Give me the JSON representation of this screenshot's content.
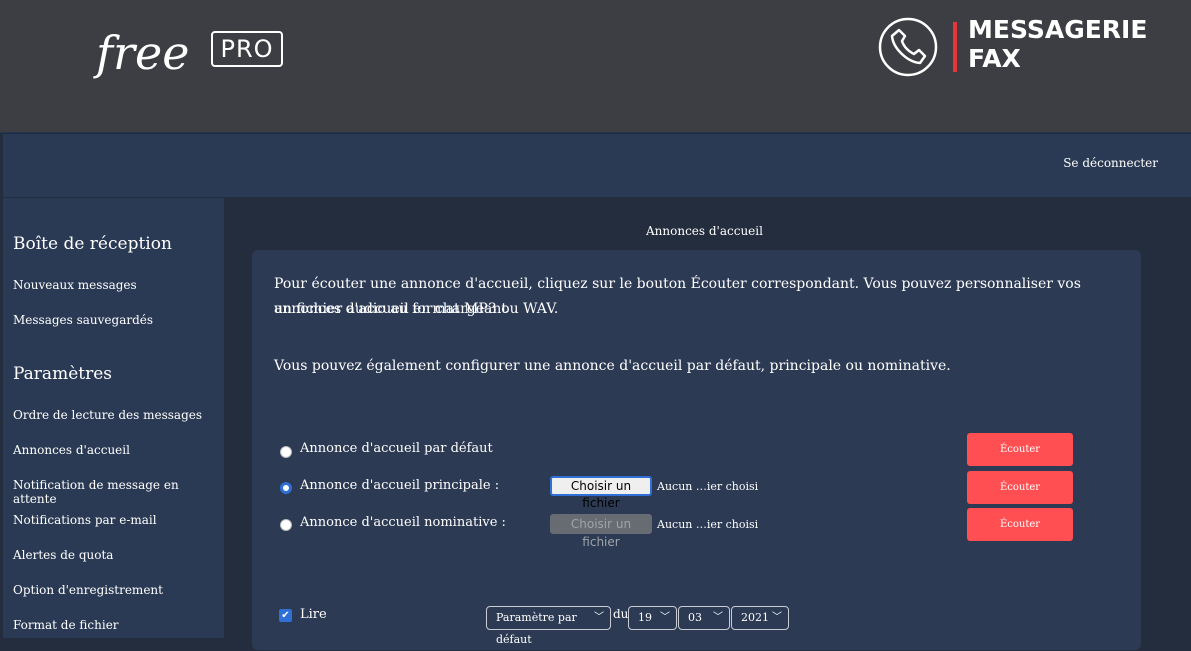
{
  "header": {
    "logo_text": "free",
    "logo_badge": "PRO",
    "product_title_line1": "MESSAGERIE",
    "product_title_line2": "FAX"
  },
  "topbar": {
    "logout_label": "Se déconnecter"
  },
  "sidebar": {
    "inbox_heading": "Boîte de réception",
    "inbox_items": [
      "Nouveaux messages",
      "Messages sauvegardés"
    ],
    "settings_heading": "Paramètres",
    "settings_items": [
      "Ordre de lecture des messages",
      "Annonces d'accueil",
      "Notification de message en attente",
      "Notifications par e-mail",
      "Alertes de quota",
      "Option d'enregistrement",
      "Format de fichier"
    ]
  },
  "main": {
    "section_title": "Annonces d'accueil",
    "intro_line1": "Pour écouter une annonce d'accueil, cliquez sur le bouton Écouter correspondant. Vous pouvez personnaliser vos annonces d'accueil en chargeant",
    "intro_line2": "un fichier audio au format MP3 ou WAV.",
    "intro_line3": "Vous pouvez également configurer une annonce d'accueil par défaut, principale ou nominative.",
    "options": [
      {
        "label": "Annonce d'accueil par défaut",
        "selected": false,
        "listen_label": "Écouter"
      },
      {
        "label": "Annonce d'accueil principale :",
        "selected": true,
        "file_button": "Choisir un fichier",
        "file_status": "Aucun …ier choisi",
        "listen_label": "Écouter"
      },
      {
        "label": "Annonce d'accueil nominative :",
        "selected": false,
        "file_button": "Choisir un fichier",
        "file_status": "Aucun …ier choisi",
        "listen_label": "Écouter"
      }
    ],
    "play": {
      "checkbox_label": "Lire",
      "checked": true,
      "mode_select": "Paramètre par défaut",
      "du_label": "du",
      "day": "19",
      "month": "03",
      "year": "2021"
    }
  },
  "colors": {
    "header_bg": "#3d3e43",
    "nav_bg": "#2b3a54",
    "page_bg": "#232d3d",
    "accent_red": "#ff4f52",
    "radio_blue": "#2f6fd6"
  },
  "icons": {
    "phone": "phone-icon",
    "check": "checkmark-icon",
    "chevron": "chevron-down-icon"
  }
}
